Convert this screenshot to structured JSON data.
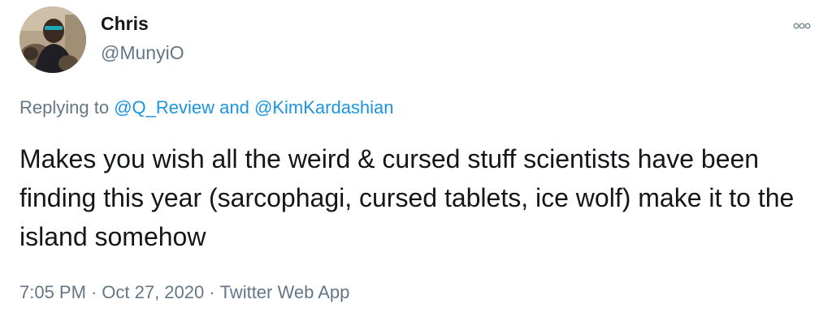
{
  "author": {
    "display_name": "Chris",
    "handle": "@MunyiO",
    "avatar_icon": "profile-photo"
  },
  "menu": {
    "icon": "more-options-icon"
  },
  "reply_context": {
    "prefix": "Replying to",
    "mention_1": "@Q_Review",
    "conjunction": "and",
    "mention_2": "@KimKardashian"
  },
  "tweet": {
    "text": "Makes you wish all the weird & cursed stuff scientists have been finding this year (sarcophagi, cursed tablets, ice wolf) make it to the island somehow"
  },
  "meta": {
    "time": "7:05 PM",
    "separator": "·",
    "date": "Oct 27, 2020",
    "source": "Twitter Web App"
  },
  "colors": {
    "link": "#1b95e0",
    "secondary": "#657786",
    "text": "#14171a"
  }
}
